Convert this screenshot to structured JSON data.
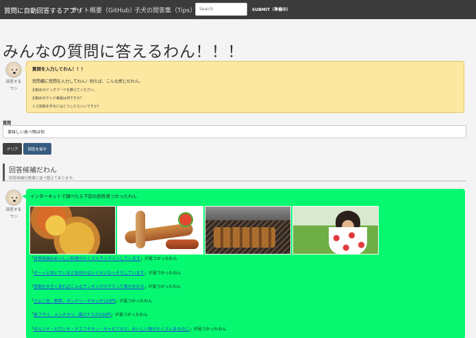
{
  "navbar": {
    "brand": "質問に自動回答するアプリ",
    "links": [
      {
        "label": "サイト概要（GitHub）",
        "caret": "⌄"
      },
      {
        "label": "子犬の問答集（Tips）",
        "caret": "⌄"
      }
    ],
    "search_placeholder": "Search",
    "submit_label": "SUBMIT（準備中）"
  },
  "page_title": "みんなの質問に答えるわん！！！",
  "bot": {
    "name_line1": "回答する",
    "name_line2": "ワン"
  },
  "question_bubble": {
    "heading": "質問を入力してわん！！！",
    "instruction": "質問欄に質問を入力してわん！例えば、こんな感じだわん。",
    "examples": [
      "お勧めのドッグフードを教えてください。",
      "お勧めのテレビ番組は何ですか？",
      "人工知能を作るにはどうしたらいいですか？"
    ]
  },
  "form": {
    "label": "質問",
    "value": "美味しい食べ物は何",
    "clear_button": "クリア",
    "search_button": "回答を探す"
  },
  "candidates": {
    "title": "回答候補だわん",
    "subtitle": "回答候補の質順に並べ替えてあります。"
  },
  "answer": {
    "intro": "インターネットで調べたら下記の回答見つかったわん",
    "images": [
      "pizza-photo",
      "sausage-photo",
      "bbq-photo",
      "puppy-photo"
    ],
    "results": [
      {
        "pre": "「",
        "link": "世界各国のおいしい料理がたくさんランクインしています",
        "post": "」が見つかったわん"
      },
      {
        "pre": "「",
        "link": "ボーッと歩いていると気付かないぐらいひっそりしています",
        "post": "」が見つかったわん"
      },
      {
        "pre": "「",
        "link": "感謝を大きく見ればこんなランキングがクズって事が分かる",
        "post": "」が見つかったわん"
      },
      {
        "pre": "「",
        "link": "ひよこ豆、野菜、タンドリーチキンが120円",
        "post": "」が見つかったわん"
      },
      {
        "pre": "「",
        "link": "魚フライ、メンチカツ、揚げナスが230円",
        "post": "」が見つかったわん"
      },
      {
        "pre": "「",
        "link": "ボルシチ・ピロシキ・キエフチキン・キャビアなど、おいしい物がたくさんあるのに",
        "post": "」が見つかったわん"
      }
    ]
  },
  "colors": {
    "navbar": "#3b3b3b",
    "question_bubble": "#fde8a2",
    "answer_bubble": "#06f870",
    "link": "#1d3fd9",
    "search_button": "#375a7f"
  }
}
